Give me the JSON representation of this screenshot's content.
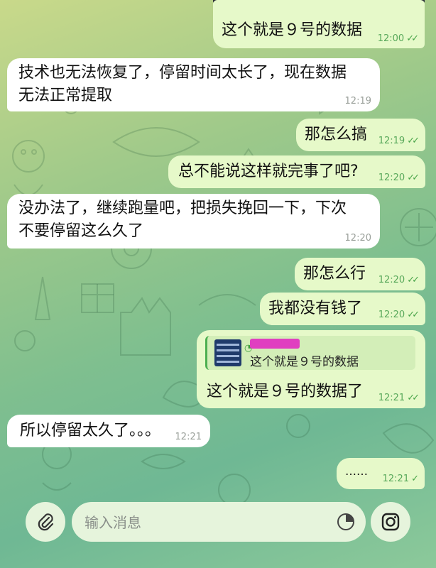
{
  "messages": [
    {
      "side": "out",
      "text": "这个就是９号的数据",
      "time": "12:00",
      "ticks": "✓✓"
    },
    {
      "side": "in",
      "text1": "技术也无法恢复了，停留时间太长了，现在数据",
      "text2": "无法正常提取",
      "time": "12:19"
    },
    {
      "side": "out",
      "text": "那怎么搞",
      "time": "12:19",
      "ticks": "✓✓"
    },
    {
      "side": "out",
      "text": "总不能说这样就完事了吧?",
      "time": "12:20",
      "ticks": "✓✓"
    },
    {
      "side": "in",
      "text1": "没办法了，继续跑量吧，把损失挽回一下，下次",
      "text2": "不要停留这么久了",
      "time": "12:20"
    },
    {
      "side": "out",
      "text": "那怎么行",
      "time": "12:20",
      "ticks": "✓✓"
    },
    {
      "side": "out",
      "text": "我都没有钱了",
      "time": "12:20",
      "ticks": "✓✓"
    },
    {
      "side": "out",
      "reply_text": "这个就是９号的数据",
      "text": "这个就是９号的数据了",
      "time": "12:21",
      "ticks": "✓✓"
    },
    {
      "side": "in",
      "text": "所以停留太久了。。。",
      "time": "12:21"
    },
    {
      "side": "out",
      "text": "……",
      "time": "12:21",
      "ticks": "✓"
    }
  ],
  "composer": {
    "placeholder": "输入消息"
  },
  "icons": {
    "attach": "paperclip-icon",
    "sticker": "sticker-icon",
    "camera": "instagram-camera-icon"
  }
}
